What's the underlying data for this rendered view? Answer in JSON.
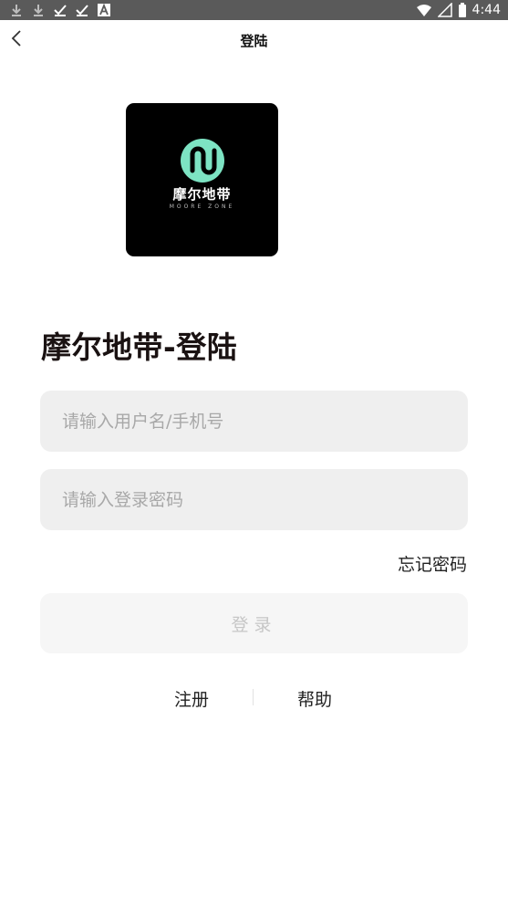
{
  "status_bar": {
    "time": "4:44",
    "icons": [
      "download-icon",
      "download-icon",
      "check-icon",
      "check-icon",
      "a-icon",
      "wifi-icon",
      "signal-icon",
      "battery-icon"
    ]
  },
  "header": {
    "title": "登陆"
  },
  "logo": {
    "name_cn": "摩尔地带",
    "name_en": "MOORE ZONE",
    "accent": "#7de3c3"
  },
  "login": {
    "heading": "摩尔地带-登陆",
    "username_placeholder": "请输入用户名/手机号",
    "password_placeholder": "请输入登录密码",
    "forgot_label": "忘记密码",
    "submit_label": "登录"
  },
  "links": {
    "register": "注册",
    "help": "帮助"
  }
}
